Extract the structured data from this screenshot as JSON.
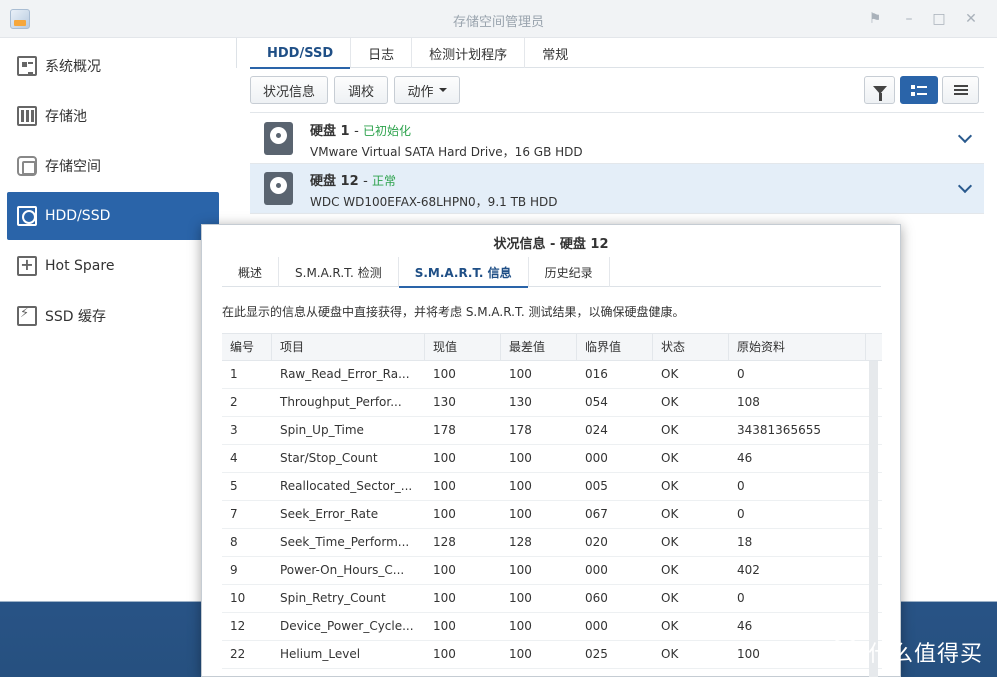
{
  "window": {
    "title": "存储空间管理员"
  },
  "sidebar": {
    "items": [
      {
        "label": "系统概况",
        "icon": "overview-icon"
      },
      {
        "label": "存储池",
        "icon": "storage-pool-icon"
      },
      {
        "label": "存储空间",
        "icon": "volume-icon"
      },
      {
        "label": "HDD/SSD",
        "icon": "hdd-icon",
        "active": true
      },
      {
        "label": "Hot Spare",
        "icon": "hot-spare-icon"
      },
      {
        "label": "SSD 缓存",
        "icon": "ssd-cache-icon"
      }
    ]
  },
  "main": {
    "tabs": [
      "HDD/SSD",
      "日志",
      "检测计划程序",
      "常规"
    ],
    "toolbar": {
      "status_label": "状况信息",
      "tune_label": "调校",
      "action_label": "动作"
    },
    "disks": [
      {
        "name": "硬盘 1",
        "status": "已初始化",
        "desc": "VMware Virtual SATA Hard Drive，16 GB HDD"
      },
      {
        "name": "硬盘 12",
        "status": "正常",
        "desc": "WDC WD100EFAX-68LHPN0，9.1 TB HDD"
      }
    ]
  },
  "dialog": {
    "title": "状况信息 - 硬盘 12",
    "tabs": [
      "概述",
      "S.M.A.R.T. 检测",
      "S.M.A.R.T. 信息",
      "历史纪录"
    ],
    "description": "在此显示的信息从硬盘中直接获得，并将考虑 S.M.A.R.T. 测试结果，以确保硬盘健康。",
    "table": {
      "headers": [
        "编号",
        "项目",
        "现值",
        "最差值",
        "临界值",
        "状态",
        "原始资料"
      ],
      "rows": [
        [
          "1",
          "Raw_Read_Error_Ra...",
          "100",
          "100",
          "016",
          "OK",
          "0"
        ],
        [
          "2",
          "Throughput_Perfor...",
          "130",
          "130",
          "054",
          "OK",
          "108"
        ],
        [
          "3",
          "Spin_Up_Time",
          "178",
          "178",
          "024",
          "OK",
          "34381365655"
        ],
        [
          "4",
          "Star/Stop_Count",
          "100",
          "100",
          "000",
          "OK",
          "46"
        ],
        [
          "5",
          "Reallocated_Sector_...",
          "100",
          "100",
          "005",
          "OK",
          "0"
        ],
        [
          "7",
          "Seek_Error_Rate",
          "100",
          "100",
          "067",
          "OK",
          "0"
        ],
        [
          "8",
          "Seek_Time_Perform...",
          "128",
          "128",
          "020",
          "OK",
          "18"
        ],
        [
          "9",
          "Power-On_Hours_C...",
          "100",
          "100",
          "000",
          "OK",
          "402"
        ],
        [
          "10",
          "Spin_Retry_Count",
          "100",
          "100",
          "060",
          "OK",
          "0"
        ],
        [
          "12",
          "Device_Power_Cycle...",
          "100",
          "100",
          "000",
          "OK",
          "46"
        ],
        [
          "22",
          "Helium_Level",
          "100",
          "100",
          "025",
          "OK",
          "100"
        ]
      ]
    }
  },
  "watermark": {
    "logo": "值",
    "text": "什么值得买"
  }
}
